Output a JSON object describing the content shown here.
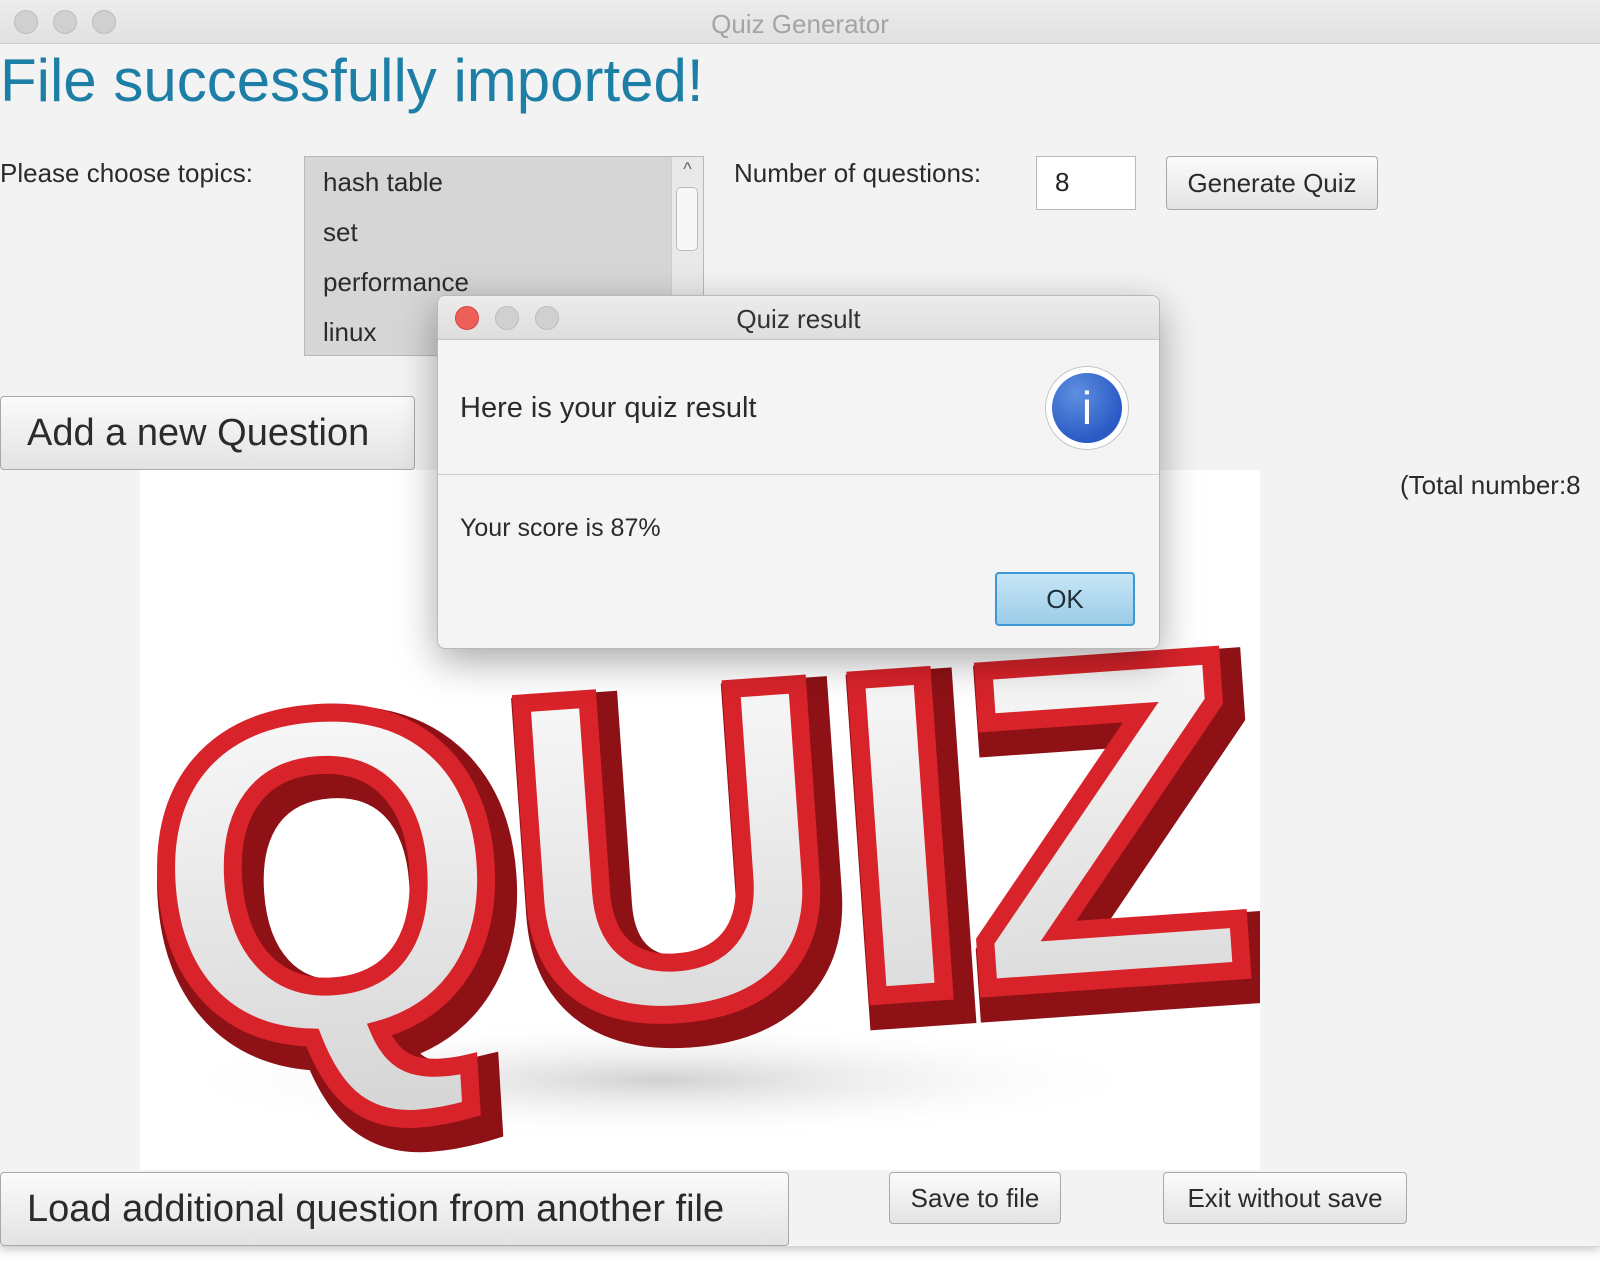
{
  "window": {
    "title": "Quiz Generator"
  },
  "headline": "File successfully imported!",
  "topics": {
    "label": "Please choose topics:",
    "items": [
      "hash table",
      "set",
      "performance",
      "linux"
    ],
    "scroll_up_glyph": "^"
  },
  "questions": {
    "label": "Number of questions:",
    "value": "8"
  },
  "buttons": {
    "generate": "Generate Quiz",
    "add_question": "Add a new Question",
    "load": "Load additional question from another file",
    "save": "Save to file",
    "exit": "Exit without save"
  },
  "total_label": "(Total number:8",
  "quiz_image": {
    "word": "QUIZ!"
  },
  "dialog": {
    "title": "Quiz result",
    "header": "Here is your quiz result",
    "content": "Your score is 87%",
    "ok": "OK",
    "icon": "info-icon",
    "icon_glyph": "i"
  },
  "colors": {
    "headline": "#1d7fa6",
    "close_red": "#ed5f58",
    "info_blue": "#2a5bc5",
    "ok_border": "#3c97d6",
    "quiz_red": "#d8232a"
  }
}
